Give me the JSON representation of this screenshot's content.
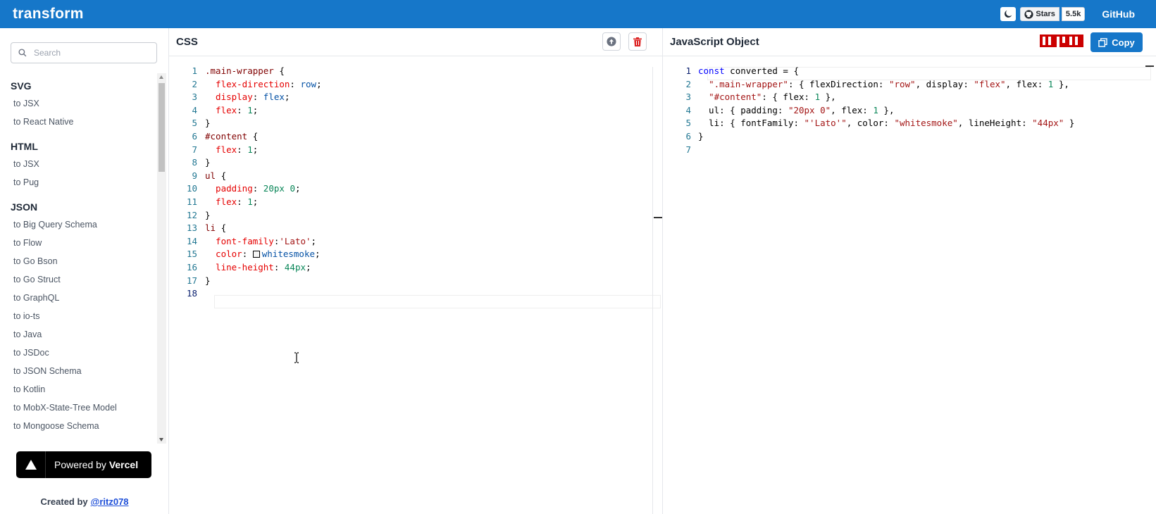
{
  "app": {
    "title": "transform"
  },
  "topbar": {
    "stars_label": "Stars",
    "stars_count": "5.5k",
    "github_label": "GitHub"
  },
  "sidebar": {
    "search_placeholder": "Search",
    "groups": [
      {
        "title": "SVG",
        "items": [
          "to JSX",
          "to React Native"
        ]
      },
      {
        "title": "HTML",
        "items": [
          "to JSX",
          "to Pug"
        ]
      },
      {
        "title": "JSON",
        "items": [
          "to Big Query Schema",
          "to Flow",
          "to Go Bson",
          "to Go Struct",
          "to GraphQL",
          "to io-ts",
          "to Java",
          "to JSDoc",
          "to JSON Schema",
          "to Kotlin",
          "to MobX-State-Tree Model",
          "to Mongoose Schema"
        ]
      }
    ],
    "powered_by": "Powered by",
    "powered_brand": "Vercel",
    "created_by": "Created by",
    "author": "@ritz078"
  },
  "css_panel": {
    "title": "CSS",
    "line_numbers": [
      "1",
      "2",
      "3",
      "4",
      "5",
      "6",
      "7",
      "8",
      "9",
      "10",
      "11",
      "12",
      "13",
      "14",
      "15",
      "16",
      "17",
      "18"
    ],
    "code": [
      [
        {
          "t": ".main-wrapper",
          "c": "sel"
        },
        {
          "t": " {",
          "c": "p"
        }
      ],
      [
        {
          "t": "  flex-direction",
          "c": "prop"
        },
        {
          "t": ": ",
          "c": "p"
        },
        {
          "t": "row",
          "c": "val"
        },
        {
          "t": ";",
          "c": "p"
        }
      ],
      [
        {
          "t": "  display",
          "c": "prop"
        },
        {
          "t": ": ",
          "c": "p"
        },
        {
          "t": "flex",
          "c": "val"
        },
        {
          "t": ";",
          "c": "p"
        }
      ],
      [
        {
          "t": "  flex",
          "c": "prop"
        },
        {
          "t": ": ",
          "c": "p"
        },
        {
          "t": "1",
          "c": "num"
        },
        {
          "t": ";",
          "c": "p"
        }
      ],
      [
        {
          "t": "}",
          "c": "p"
        }
      ],
      [
        {
          "t": "#content",
          "c": "sel"
        },
        {
          "t": " {",
          "c": "p"
        }
      ],
      [
        {
          "t": "  flex",
          "c": "prop"
        },
        {
          "t": ": ",
          "c": "p"
        },
        {
          "t": "1",
          "c": "num"
        },
        {
          "t": ";",
          "c": "p"
        }
      ],
      [
        {
          "t": "}",
          "c": "p"
        }
      ],
      [
        {
          "t": "ul",
          "c": "sel"
        },
        {
          "t": " {",
          "c": "p"
        }
      ],
      [
        {
          "t": "  padding",
          "c": "prop"
        },
        {
          "t": ": ",
          "c": "p"
        },
        {
          "t": "20px",
          "c": "num"
        },
        {
          "t": " ",
          "c": "p"
        },
        {
          "t": "0",
          "c": "num"
        },
        {
          "t": ";",
          "c": "p"
        }
      ],
      [
        {
          "t": "  flex",
          "c": "prop"
        },
        {
          "t": ": ",
          "c": "p"
        },
        {
          "t": "1",
          "c": "num"
        },
        {
          "t": ";",
          "c": "p"
        }
      ],
      [
        {
          "t": "}",
          "c": "p"
        }
      ],
      [
        {
          "t": "li",
          "c": "sel"
        },
        {
          "t": " {",
          "c": "p"
        }
      ],
      [
        {
          "t": "  font-family",
          "c": "prop"
        },
        {
          "t": ":",
          "c": "p"
        },
        {
          "t": "'Lato'",
          "c": "str"
        },
        {
          "t": ";",
          "c": "p"
        }
      ],
      [
        {
          "t": "  color",
          "c": "prop"
        },
        {
          "t": ": ",
          "c": "p"
        },
        {
          "t": "",
          "c": "swatch"
        },
        {
          "t": "whitesmoke",
          "c": "val"
        },
        {
          "t": ";",
          "c": "p"
        }
      ],
      [
        {
          "t": "  line-height",
          "c": "prop"
        },
        {
          "t": ": ",
          "c": "p"
        },
        {
          "t": "44px",
          "c": "num"
        },
        {
          "t": ";",
          "c": "p"
        }
      ],
      [
        {
          "t": "}",
          "c": "p"
        }
      ],
      []
    ]
  },
  "js_panel": {
    "title": "JavaScript Object",
    "copy_label": "Copy",
    "line_numbers": [
      "1",
      "2",
      "3",
      "4",
      "5",
      "6",
      "7"
    ],
    "code": [
      [
        {
          "t": "const",
          "c": "kw"
        },
        {
          "t": " converted = {",
          "c": "p"
        }
      ],
      [
        {
          "t": "  ",
          "c": "p"
        },
        {
          "t": "\".main-wrapper\"",
          "c": "str"
        },
        {
          "t": ": { flexDirection: ",
          "c": "p"
        },
        {
          "t": "\"row\"",
          "c": "str"
        },
        {
          "t": ", display: ",
          "c": "p"
        },
        {
          "t": "\"flex\"",
          "c": "str"
        },
        {
          "t": ", flex: ",
          "c": "p"
        },
        {
          "t": "1",
          "c": "num"
        },
        {
          "t": " },",
          "c": "p"
        }
      ],
      [
        {
          "t": "  ",
          "c": "p"
        },
        {
          "t": "\"#content\"",
          "c": "str"
        },
        {
          "t": ": { flex: ",
          "c": "p"
        },
        {
          "t": "1",
          "c": "num"
        },
        {
          "t": " },",
          "c": "p"
        }
      ],
      [
        {
          "t": "  ul: { padding: ",
          "c": "p"
        },
        {
          "t": "\"20px 0\"",
          "c": "str"
        },
        {
          "t": ", flex: ",
          "c": "p"
        },
        {
          "t": "1",
          "c": "num"
        },
        {
          "t": " },",
          "c": "p"
        }
      ],
      [
        {
          "t": "  li: { fontFamily: ",
          "c": "p"
        },
        {
          "t": "\"'Lato'\"",
          "c": "str"
        },
        {
          "t": ", color: ",
          "c": "p"
        },
        {
          "t": "\"whitesmoke\"",
          "c": "str"
        },
        {
          "t": ", lineHeight: ",
          "c": "p"
        },
        {
          "t": "\"44px\"",
          "c": "str"
        },
        {
          "t": " }",
          "c": "p"
        }
      ],
      [
        {
          "t": "}",
          "c": "p"
        }
      ],
      []
    ]
  },
  "colors": {
    "accent": "#1677c9",
    "npm": "#cb0000",
    "delete": "#dc2626"
  }
}
